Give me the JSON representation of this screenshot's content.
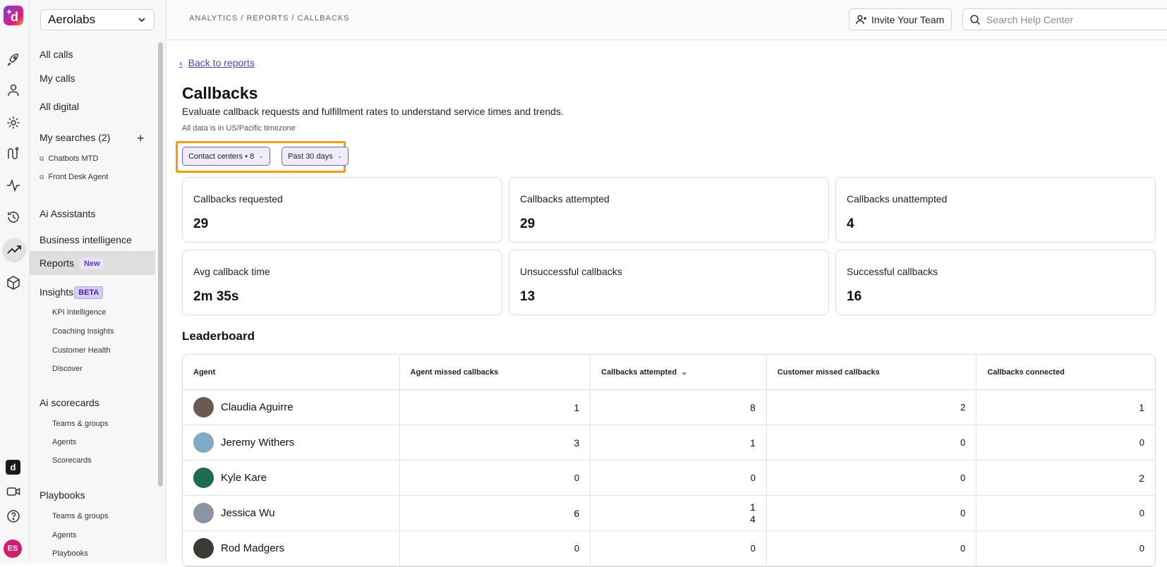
{
  "rail": {
    "logo_letter": "d",
    "bottom_square_letter": "d",
    "user_initials": "ES",
    "icons": [
      "rocket-icon",
      "person-icon",
      "gear-icon",
      "route-icon",
      "activity-icon",
      "history-icon",
      "trending-icon",
      "cube-icon",
      "video-icon",
      "help-icon"
    ]
  },
  "sidebar": {
    "org": "Aerolabs",
    "all_calls": "All calls",
    "my_calls": "My calls",
    "all_digital": "All digital",
    "my_searches": "My searches (2)",
    "searches": [
      "Chatbots MTD",
      "Front Desk Agent"
    ],
    "ai_assistants": "Ai Assistants",
    "business_intelligence": "Business intelligence",
    "reports": "Reports",
    "reports_badge": "New",
    "insights": "Insights",
    "insights_badge": "BETA",
    "insights_items": [
      "KPI Intelligence",
      "Coaching Insights",
      "Customer Health",
      "Discover"
    ],
    "ai_scorecards": "Ai scorecards",
    "scorecards_items": [
      "Teams & groups",
      "Agents",
      "Scorecards"
    ],
    "playbooks": "Playbooks",
    "playbooks_items": [
      "Teams & groups",
      "Agents",
      "Playbooks"
    ]
  },
  "topbar": {
    "breadcrumb": "ANALYTICS / REPORTS / CALLBACKS",
    "invite_label": "Invite Your Team",
    "search_placeholder": "Search Help Center"
  },
  "page": {
    "back_label": "Back to reports",
    "title": "Callbacks",
    "subtitle": "Evaluate callback requests and fulfillment rates to understand service times and trends.",
    "timezone_note": "All data is in US/Pacific timezone",
    "filters": [
      "Contact centers • 8",
      "Past 30 days"
    ]
  },
  "cards": [
    {
      "label": "Callbacks requested",
      "value": "29"
    },
    {
      "label": "Callbacks attempted",
      "value": "29"
    },
    {
      "label": "Callbacks unattempted",
      "value": "4"
    },
    {
      "label": "Avg callback time",
      "value": "2m 35s"
    },
    {
      "label": "Unsuccessful callbacks",
      "value": "13"
    },
    {
      "label": "Successful callbacks",
      "value": "16"
    }
  ],
  "leaderboard": {
    "title": "Leaderboard",
    "columns": [
      "Agent",
      "Agent missed callbacks",
      "Callbacks attempted",
      "Customer missed callbacks",
      "Callbacks connected"
    ],
    "rows": [
      {
        "agent": "Claudia Aguirre",
        "missed": "1",
        "attempted": "8",
        "customer_missed": "2",
        "connected": "1",
        "avatar_color": "#6b5a54"
      },
      {
        "agent": "Jeremy Withers",
        "missed": "3",
        "attempted": "1",
        "customer_missed": "0",
        "connected": "0",
        "avatar_color": "#7fa9c4"
      },
      {
        "agent": "Kyle Kare",
        "missed": "0",
        "attempted": "0",
        "customer_missed": "0",
        "connected": "2",
        "avatar_color": "#1f6b4f"
      },
      {
        "agent": "Jessica Wu",
        "missed": "6",
        "attempted_line1": "1",
        "attempted_line2": "4",
        "customer_missed": "0",
        "connected": "0",
        "avatar_color": "#8a94a3"
      },
      {
        "agent": "Rod Madgers",
        "missed": "0",
        "attempted": "0",
        "customer_missed": "0",
        "connected": "0",
        "avatar_color": "#3d3a33"
      }
    ]
  },
  "colors": {
    "accent": "#5b3cc4",
    "highlight_frame": "#f59e0b",
    "brand_gradient_start": "#7c3aed",
    "user_avatar": "#d11c6f"
  }
}
